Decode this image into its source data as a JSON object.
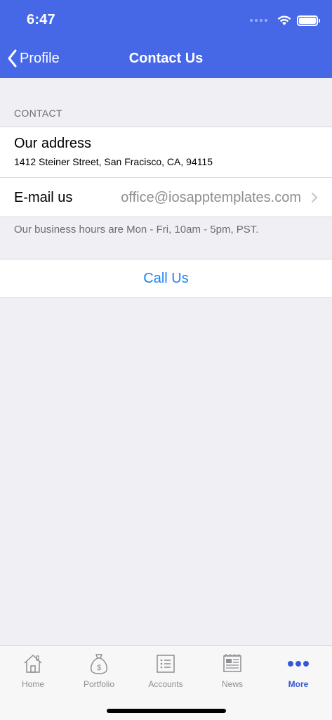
{
  "status_bar": {
    "time": "6:47"
  },
  "nav": {
    "back_label": "Profile",
    "title": "Contact Us"
  },
  "contact_section": {
    "header": "CONTACT",
    "address_title": "Our address",
    "address_value": "1412 Steiner Street, San Fracisco, CA, 94115",
    "email_label": "E-mail us",
    "email_value": "office@iosapptemplates.com",
    "footer": "Our business hours are Mon - Fri, 10am - 5pm, PST."
  },
  "call": {
    "label": "Call Us"
  },
  "tabs": [
    {
      "label": "Home",
      "icon": "house-icon"
    },
    {
      "label": "Portfolio",
      "icon": "money-bag-icon"
    },
    {
      "label": "Accounts",
      "icon": "list-icon"
    },
    {
      "label": "News",
      "icon": "newspaper-icon"
    },
    {
      "label": "More",
      "icon": "more-dots-icon",
      "active": true
    }
  ],
  "colors": {
    "accent": "#4768e6",
    "link": "#1a82f5",
    "active_tab": "#3657d6"
  }
}
